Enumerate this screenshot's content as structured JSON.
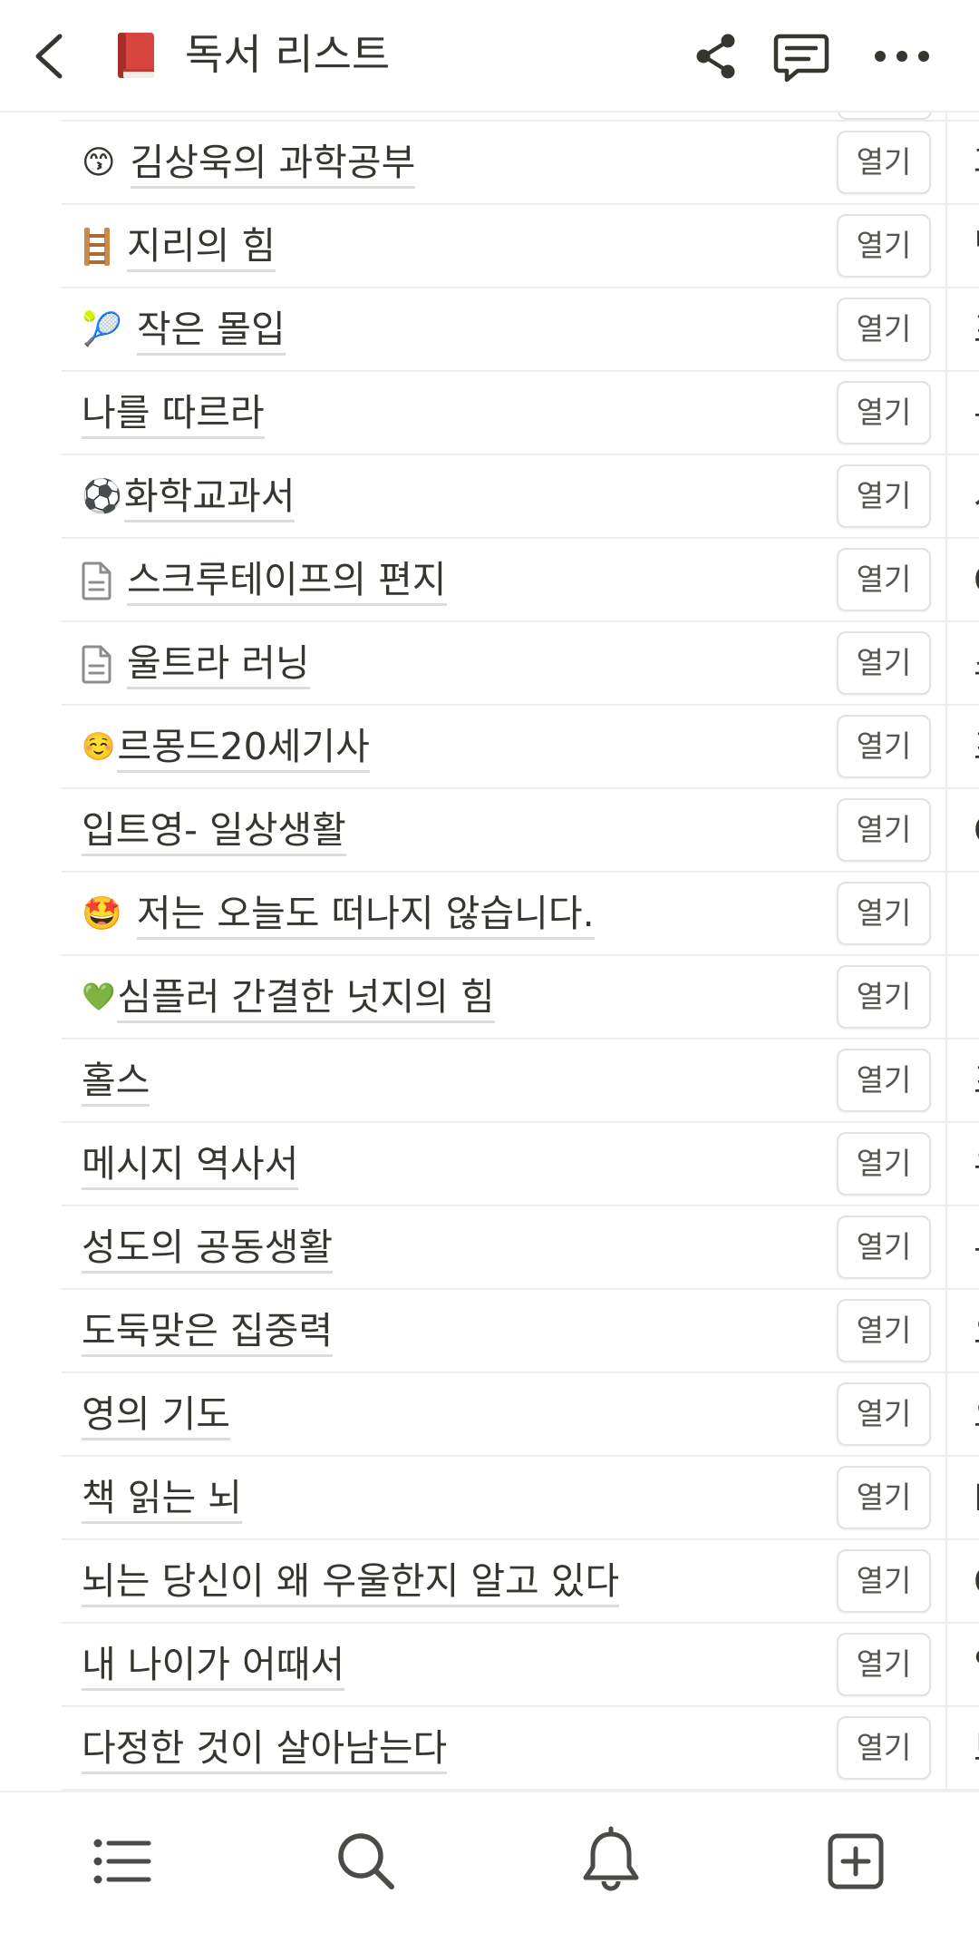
{
  "header": {
    "title": "독서 리스트",
    "page_icon": "closed-book-icon",
    "icons": [
      "back-chevron-icon",
      "share-icon",
      "comment-icon",
      "more-icon"
    ]
  },
  "table": {
    "open_label": "열기",
    "rows": [
      {
        "icon": "😙",
        "title": "김상욱의 과학공부",
        "next": "과"
      },
      {
        "icon": "ladder",
        "title": "지리의 힘",
        "next": "팀"
      },
      {
        "icon": "🎾",
        "title": "작은 몰입",
        "next": "프"
      },
      {
        "icon": "",
        "title": "나를 따르라",
        "next": "본"
      },
      {
        "icon": "⚽",
        "title": "화학교과서",
        "next": "시"
      },
      {
        "icon": "page",
        "title": "스크루테이프의 편지",
        "next": "C"
      },
      {
        "icon": "page",
        "title": "울트라 러닝",
        "next": "스"
      },
      {
        "icon": "☺️",
        "title": "르몽드20세기사",
        "next": "프"
      },
      {
        "icon": "",
        "title": "입트영- 일상생활",
        "next": "C"
      },
      {
        "icon": "🤩",
        "title": "저는 오늘도 떠나지 않습니다.",
        "next": ""
      },
      {
        "icon": "💚",
        "title": "심플러 간결한 넛지의 힘",
        "next": ""
      },
      {
        "icon": "",
        "title": "홀스",
        "next": "프"
      },
      {
        "icon": "",
        "title": "메시지 역사서",
        "next": "우"
      },
      {
        "icon": "",
        "title": "성도의 공동생활",
        "next": "본"
      },
      {
        "icon": "",
        "title": "도둑맞은 집중력",
        "next": "오"
      },
      {
        "icon": "",
        "title": "영의 기도",
        "next": "오"
      },
      {
        "icon": "",
        "title": "책 읽는 뇌",
        "next": "D"
      },
      {
        "icon": "",
        "title": "뇌는 당신이 왜 우울한지 알고 있다",
        "next": "C"
      },
      {
        "icon": "",
        "title": "내 나이가 어때서",
        "next": "임"
      },
      {
        "icon": "",
        "title": "다정한 것이 살아남는다",
        "next": "브"
      }
    ]
  },
  "bottom_nav": {
    "items": [
      "list-icon",
      "search-icon",
      "bell-icon",
      "add-page-icon"
    ]
  },
  "colors": {
    "text": "#37352f",
    "divider": "#ededec",
    "button_border": "#e3e2e0",
    "icon": "#4b4a46"
  }
}
